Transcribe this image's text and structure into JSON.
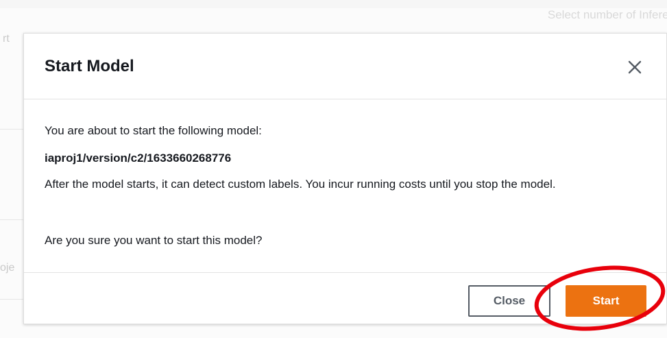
{
  "background": {
    "hint_text": "Select number of Inference",
    "left_text_1": "rt",
    "left_text_2": "oje"
  },
  "modal": {
    "title": "Start Model",
    "close_icon": "close-x-icon",
    "intro": "You are about to start the following model:",
    "model_name": "iaproj1/version/c2/1633660268776",
    "description": "After the model starts, it can detect custom labels. You incur running costs until you stop the model.",
    "confirm_question": "Are you sure you want to start this model?",
    "close_label": "Close",
    "start_label": "Start"
  },
  "colors": {
    "primary_button": "#ec7211",
    "annotation_circle": "#e8000b",
    "text": "#16191f"
  }
}
